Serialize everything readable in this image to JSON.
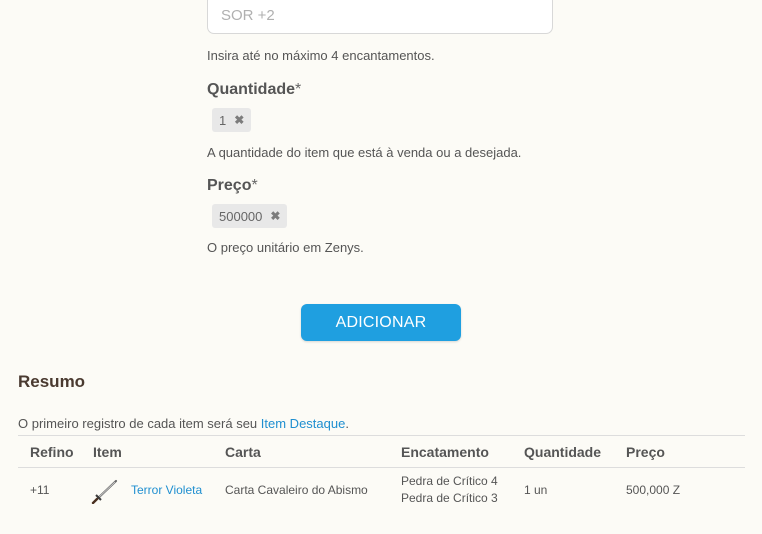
{
  "enchant": {
    "placeholder": "SOR +2",
    "help": "Insira até no máximo 4 encantamentos."
  },
  "quantity": {
    "label": "Quantidade",
    "required_mark": "*",
    "value": "1",
    "help": "A quantidade do item que está à venda ou a desejada."
  },
  "price": {
    "label": "Preço",
    "required_mark": "*",
    "value": "500000",
    "help": "O preço unitário em Zenys."
  },
  "add_button": {
    "label": "ADICIONAR"
  },
  "summary": {
    "title": "Resumo",
    "note_prefix": "O primeiro registro de cada item será seu ",
    "note_link": "Item Destaque",
    "note_suffix": ".",
    "columns": [
      "Refino",
      "Item",
      "Carta",
      "Encatamento",
      "Quantidade",
      "Preço"
    ],
    "rows": [
      {
        "refine": "+11",
        "item": "Terror Violeta",
        "item_icon": "sword-icon",
        "card": "Carta Cavaleiro do Abismo",
        "enchant1": "Pedra de Crítico 4",
        "enchant2": "Pedra de Crítico 3",
        "quantity": "1 un",
        "price": "500,000 Z"
      }
    ]
  },
  "colors": {
    "accent": "#1f9fe0",
    "link": "#1f8fd0",
    "background": "#fcfbf6",
    "tag": "#e8e8e8"
  }
}
